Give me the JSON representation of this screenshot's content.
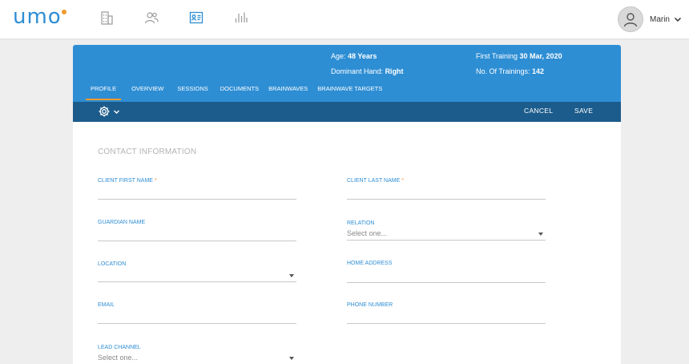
{
  "app": {
    "logo": "umo",
    "nav_icons": [
      "building-icon",
      "users-icon",
      "client-card-icon",
      "analytics-icon"
    ]
  },
  "user": {
    "name": "Marin"
  },
  "client_header": {
    "age_label": "Age:",
    "age_value": "48 Years",
    "hand_label": "Dominant Hand:",
    "hand_value": "Right",
    "first_training_label": "First Training",
    "first_training_value": "30 Mar, 2020",
    "trainings_label": "No. Of Trainings:",
    "trainings_value": "142"
  },
  "tabs": [
    "PROFILE",
    "OVERVIEW",
    "SESSIONS",
    "DOCUMENTS",
    "BRAINWAVES",
    "BRAINWAVE TARGETS"
  ],
  "toolbar": {
    "cancel_label": "CANCEL",
    "save_label": "SAVE"
  },
  "form": {
    "section_title": "CONTACT INFORMATION",
    "required_mark": "*",
    "first_name_label": "CLIENT FIRST NAME",
    "last_name_label": "CLIENT LAST NAME",
    "guardian_label": "GUARDIAN NAME",
    "relation_label": "RELATION",
    "relation_placeholder": "Select one...",
    "location_label": "LOCATION",
    "home_address_label": "HOME ADDRESS",
    "email_label": "EMAIL",
    "phone_label": "PHONE NUMBER",
    "lead_channel_label": "LEAD CHANNEL",
    "lead_channel_placeholder": "Select one..."
  },
  "colors": {
    "brand_blue": "#2e8ed4",
    "toolbar_navy": "#1c5c8c",
    "accent_orange": "#f29a2e"
  }
}
